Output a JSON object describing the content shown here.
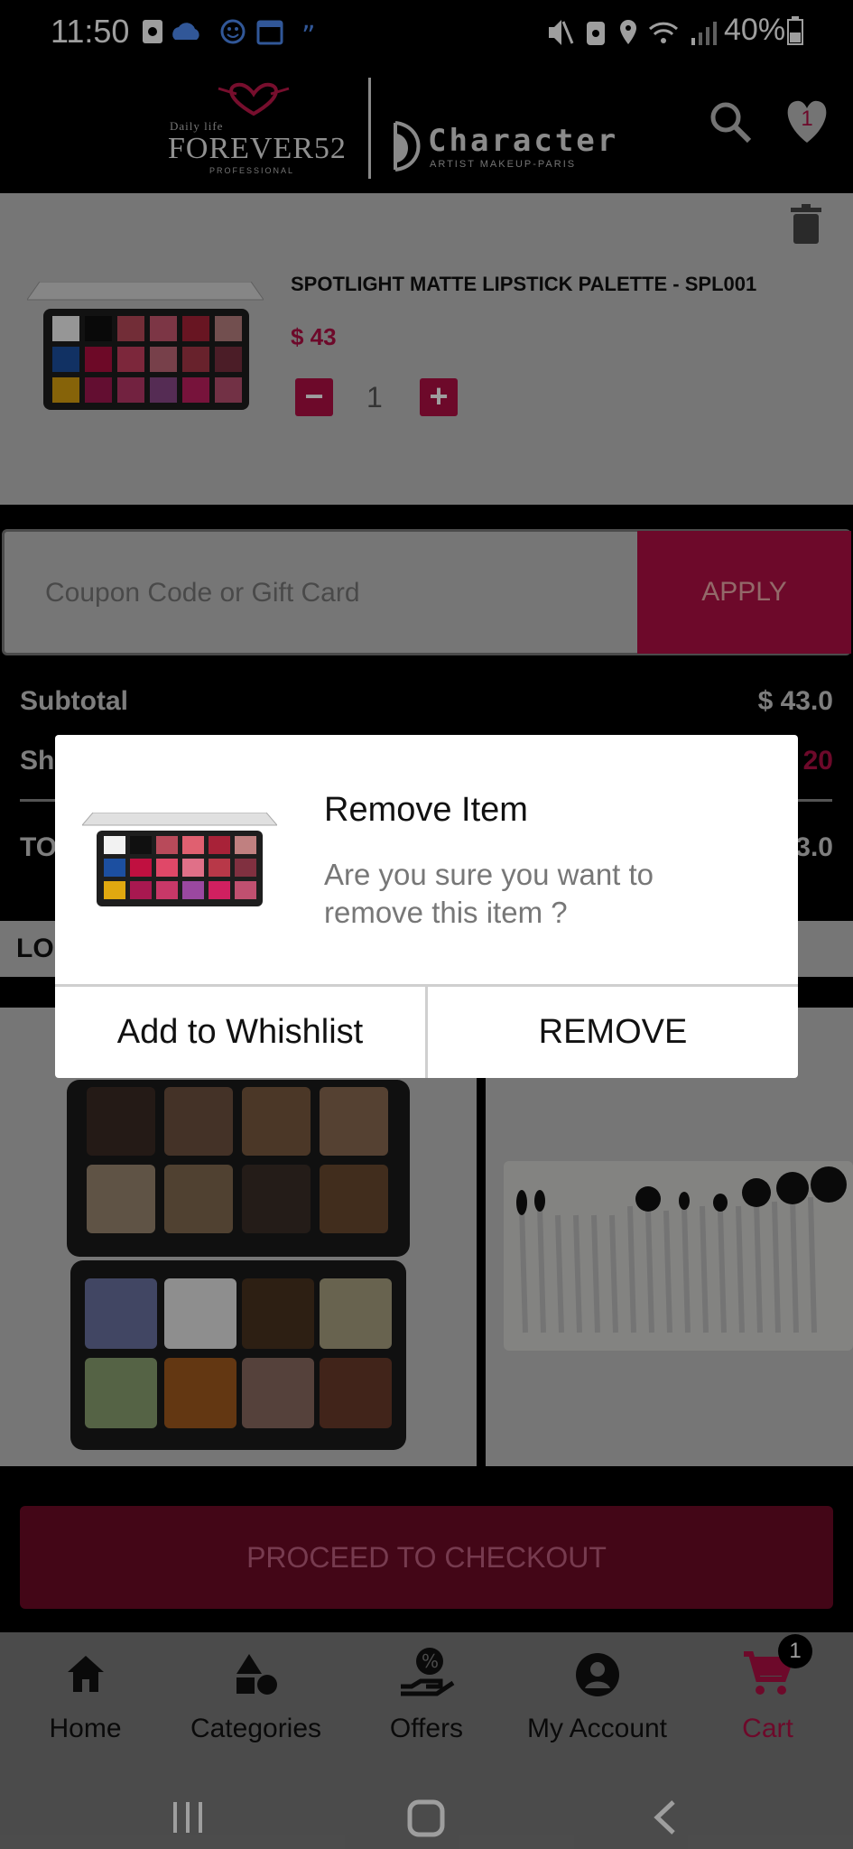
{
  "status_bar": {
    "time": "11:50",
    "battery": "40%"
  },
  "header": {
    "logo_small": "Daily life",
    "logo_main": "FOREVER52",
    "logo_sub": "PROFESSIONAL",
    "logo2_main": "Character",
    "logo2_sub": "ARTIST MAKEUP-PARIS",
    "wishlist_count": "1"
  },
  "cart_item": {
    "title": "SPOTLIGHT MATTE LIPSTICK PALETTE - SPL001",
    "price": "$ 43",
    "quantity": "1",
    "minus": "−",
    "plus": "+"
  },
  "coupon": {
    "placeholder": "Coupon Code or Gift Card",
    "apply_label": "APPLY"
  },
  "totals": {
    "subtotal_label": "Subtotal",
    "subtotal_value": "$ 43.0",
    "shipping_label_partial": "Sh",
    "shipping_value_partial": "20",
    "total_label_partial": "TO",
    "total_value_partial": "3.0"
  },
  "lower_section": {
    "heading_partial": "LO"
  },
  "checkout": {
    "label": "PROCEED TO CHECKOUT"
  },
  "bottom_nav": {
    "items": [
      {
        "label": "Home",
        "icon": "home-icon"
      },
      {
        "label": "Categories",
        "icon": "categories-icon"
      },
      {
        "label": "Offers",
        "icon": "offers-icon"
      },
      {
        "label": "My Account",
        "icon": "account-icon"
      },
      {
        "label": "Cart",
        "icon": "cart-icon"
      }
    ],
    "cart_badge": "1"
  },
  "dialog": {
    "title": "Remove Item",
    "message": "Are you sure you want to remove this item ?",
    "secondary_label": "Add to Whishlist",
    "primary_label": "REMOVE"
  },
  "colors": {
    "accent": "#b00f45",
    "background": "#000000"
  }
}
